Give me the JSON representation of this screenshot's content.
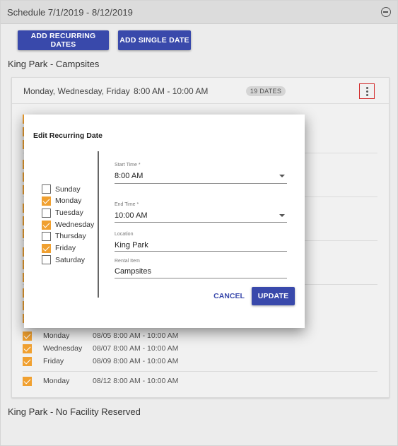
{
  "header": {
    "title": "Schedule 7/1/2019 - 8/12/2019"
  },
  "buttons": {
    "add_recurring": "ADD RECURRING DATES",
    "add_single": "ADD SINGLE DATE"
  },
  "facilities": [
    {
      "title": "King Park - Campsites"
    },
    {
      "title": "King Park - No Facility Reserved"
    }
  ],
  "card": {
    "days": "Monday, Wednesday, Friday",
    "time": "8:00 AM - 10:00 AM",
    "badge": "19 DATES"
  },
  "visible_rows": [
    {
      "day": "Monday",
      "datetime": "08/05 8:00 AM - 10:00 AM",
      "checked": true
    },
    {
      "day": "Wednesday",
      "datetime": "08/07 8:00 AM - 10:00 AM",
      "checked": true
    },
    {
      "day": "Friday",
      "datetime": "08/09 8:00 AM - 10:00 AM",
      "checked": true
    },
    {
      "day": "Monday",
      "datetime": "08/12 8:00 AM - 10:00 AM",
      "checked": true
    }
  ],
  "dialog": {
    "title": "Edit Recurring Date",
    "days": [
      {
        "label": "Sunday",
        "checked": false
      },
      {
        "label": "Monday",
        "checked": true
      },
      {
        "label": "Tuesday",
        "checked": false
      },
      {
        "label": "Wednesday",
        "checked": true
      },
      {
        "label": "Thursday",
        "checked": false
      },
      {
        "label": "Friday",
        "checked": true
      },
      {
        "label": "Saturday",
        "checked": false
      }
    ],
    "start_time": {
      "label": "Start Time *",
      "value": "8:00 AM"
    },
    "end_time": {
      "label": "End Time *",
      "value": "10:00 AM"
    },
    "location": {
      "label": "Location",
      "value": "King Park"
    },
    "rental_item": {
      "label": "Rental Item",
      "value": "Campsites"
    },
    "cancel": "CANCEL",
    "update": "UPDATE"
  },
  "colors": {
    "primary": "#3949ab",
    "checkbox": "#f0a030",
    "highlight": "#d32f2f"
  }
}
